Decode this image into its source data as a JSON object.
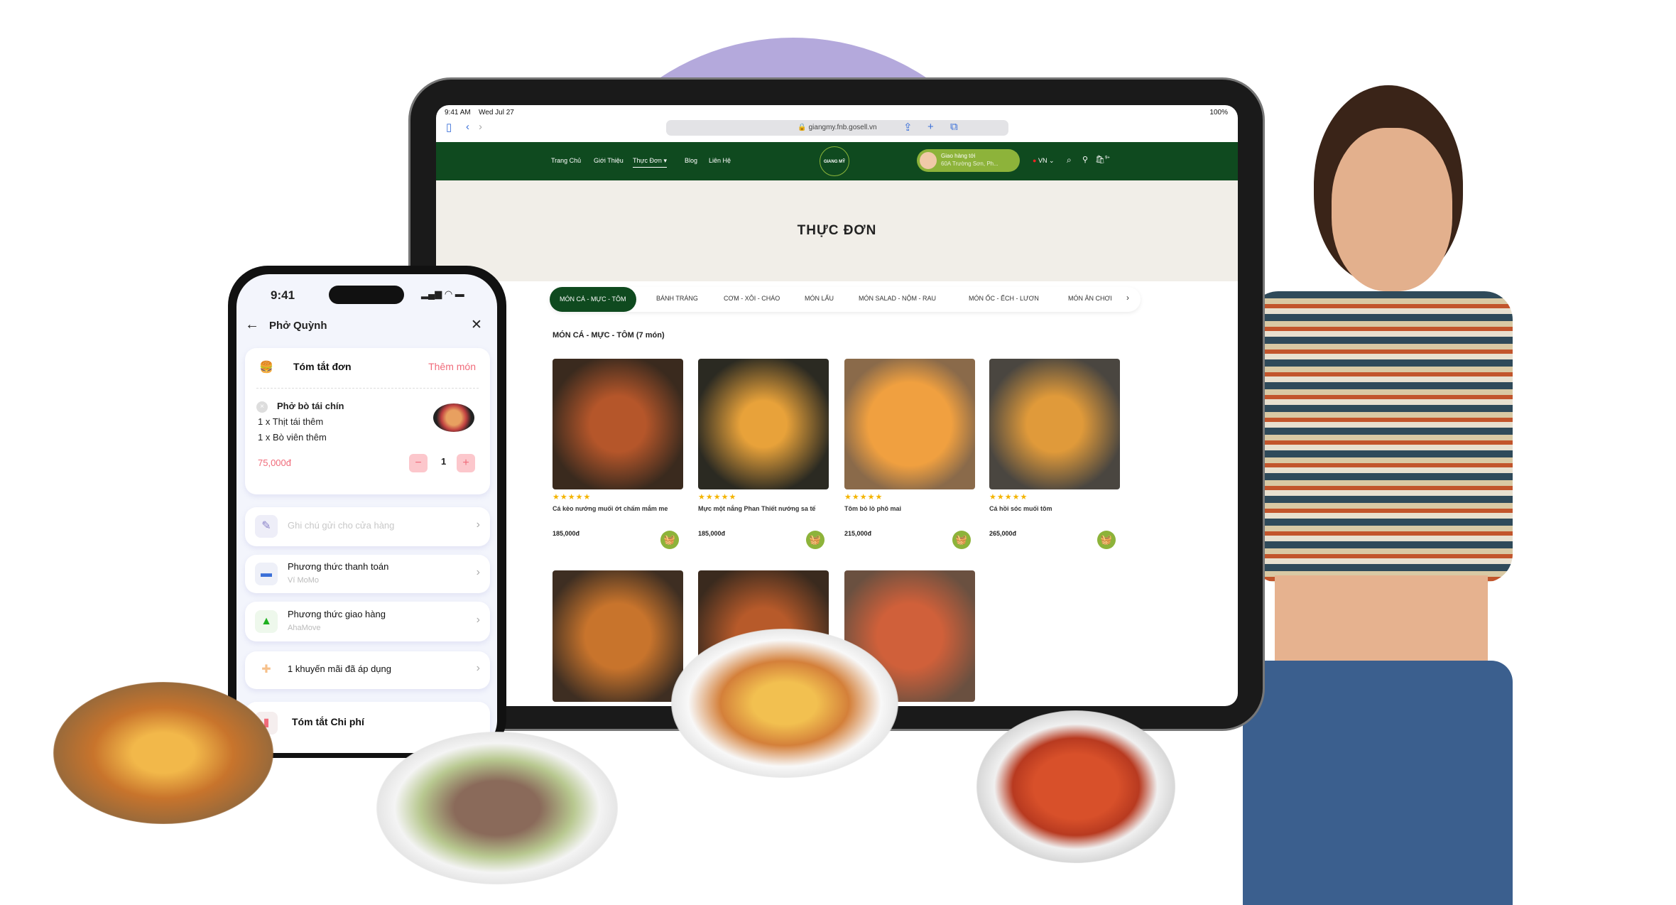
{
  "tablet": {
    "status": {
      "time": "9:41 AM",
      "date": "Wed Jul 27",
      "battery": "100%"
    },
    "url": "giangmy.fnb.gosell.vn",
    "nav": {
      "items": [
        "Trang Chủ",
        "Giới Thiệu",
        "Thực Đơn",
        "Blog",
        "Liên Hệ"
      ],
      "active": "Thực Đơn",
      "logo": "GIANG MỸ",
      "delivery_title": "Giao hàng tới",
      "delivery_address": "60A Trường Sơn, Ph...",
      "language": "VN",
      "cart_badge": "9+"
    },
    "hero_title": "THỰC ĐƠN",
    "tabs": [
      "MÓN CÁ - MỰC - TÔM",
      "BÁNH TRÁNG",
      "CƠM - XÔI - CHÁO",
      "MÓN LẨU",
      "MÓN SALAD - NỘM - RAU",
      "MÓN ỐC - ẾCH - LƯƠN",
      "MÓN ĂN CHƠI"
    ],
    "section_title": "MÓN CÁ - MỰC - TÔM (7 món)",
    "products": [
      {
        "name": "Cá kèo nướng muối ớt chấm mắm me",
        "price": "185,000đ",
        "rating": 5
      },
      {
        "name": "Mực một nắng Phan Thiết nướng sa tế",
        "price": "185,000đ",
        "rating": 5
      },
      {
        "name": "Tôm bỏ lò phô mai",
        "price": "215,000đ",
        "rating": 5
      },
      {
        "name": "Cá hồi sóc muối tôm",
        "price": "265,000đ",
        "rating": 5
      }
    ],
    "colors": {
      "brand_green": "#0f4a1f",
      "accent_green": "#8db33a",
      "star": "#f4b400"
    }
  },
  "phone": {
    "time": "9:41",
    "title": "Phở Quỳnh",
    "summary": {
      "title": "Tóm tắt đơn",
      "add_more": "Thêm món",
      "item": "Phở bò tái chín",
      "options": [
        "1 x Thịt tái thêm",
        "1 x Bò viên thêm"
      ],
      "price": "75,000đ",
      "quantity": "1"
    },
    "note_placeholder": "Ghi chú gửi cho cửa hàng",
    "payment": {
      "title": "Phương thức thanh toán",
      "value": "Ví MoMo"
    },
    "delivery": {
      "title": "Phương thức giao hàng",
      "value": "AhaMove"
    },
    "promo": "1 khuyến mãi đã áp dụng",
    "cost_summary": "Tóm tắt Chi phí",
    "colors": {
      "accent": "#f06b7a"
    }
  }
}
